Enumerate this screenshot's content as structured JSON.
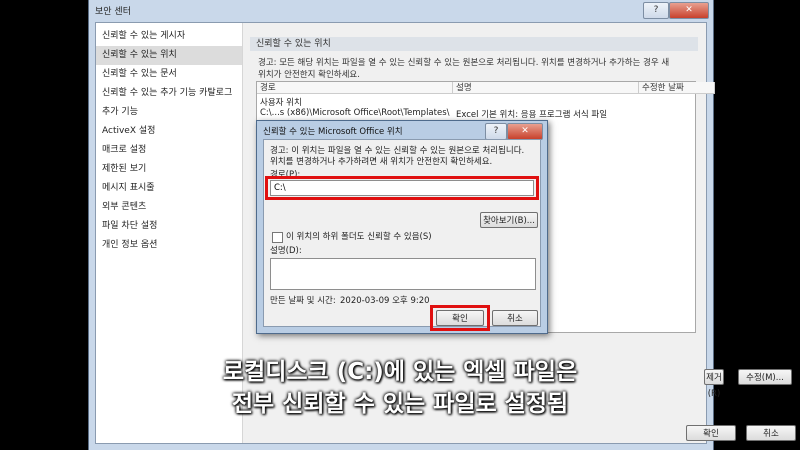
{
  "window": {
    "title": "보안 센터",
    "help_btn": "?",
    "close_btn": "✕"
  },
  "nav": {
    "items": [
      {
        "label": "신뢰할 수 있는 게시자",
        "selected": false
      },
      {
        "label": "신뢰할 수 있는 위치",
        "selected": true
      },
      {
        "label": "신뢰할 수 있는 문서",
        "selected": false
      },
      {
        "label": "신뢰할 수 있는 추가 기능 카탈로그",
        "selected": false
      },
      {
        "label": "추가 기능",
        "selected": false
      },
      {
        "label": "ActiveX 설정",
        "selected": false
      },
      {
        "label": "매크로 설정",
        "selected": false
      },
      {
        "label": "제한된 보기",
        "selected": false
      },
      {
        "label": "메시지 표시줄",
        "selected": false
      },
      {
        "label": "외부 콘텐츠",
        "selected": false
      },
      {
        "label": "파일 차단 설정",
        "selected": false
      },
      {
        "label": "개인 정보 옵션",
        "selected": false
      }
    ]
  },
  "main": {
    "section_title": "신뢰할 수 있는 위치",
    "warning_line1": "경고: 모든 해당 위치는 파일을 열 수 있는 신뢰할 수 있는 원본으로 처리됩니다. 위치를 변경하거나 추가하는 경우 새",
    "warning_line2": "위치가 안전한지 확인하세요.",
    "table": {
      "col_path": "경로",
      "col_desc": "설명",
      "col_date": "수정한 날짜",
      "group": "사용자 위치",
      "row1_path": "C:\\...s (x86)\\Microsoft Office\\Root\\Templates\\",
      "row1_desc": "Excel 기본 위치: 응용 프로그램 서식 파일"
    },
    "btn_remove": "제거(R)",
    "btn_modify": "수정(M)..."
  },
  "footer": {
    "ok": "확인",
    "cancel": "취소"
  },
  "dialog": {
    "title": "신뢰할 수 있는 Microsoft Office 위치",
    "help_btn": "?",
    "close_btn": "✕",
    "warning_line1": "경고: 이 위치는 파일을 열 수 있는 신뢰할 수 있는 원본으로 처리됩니다.",
    "warning_line2": "위치를 변경하거나 추가하려면 새 위치가 안전한지 확인하세요.",
    "path_label": "경로(P):",
    "path_value": "C:\\",
    "browse": "찾아보기(B)...",
    "subfolder_label": "이 위치의 하위 폴더도 신뢰할 수 있음(S)",
    "description_label": "설명(D):",
    "date_label": "만든 날짜 및 시간:",
    "date_value": "2020-03-09 오후 9:20",
    "ok": "확인",
    "cancel": "취소"
  },
  "caption": {
    "line1": "로컬디스크 (C:)에 있는 엑셀 파일은",
    "line2": "전부 신뢰할 수 있는 파일로 설정됨"
  },
  "colors": {
    "highlight": "#e01010",
    "caption_text": "#ffffff"
  }
}
